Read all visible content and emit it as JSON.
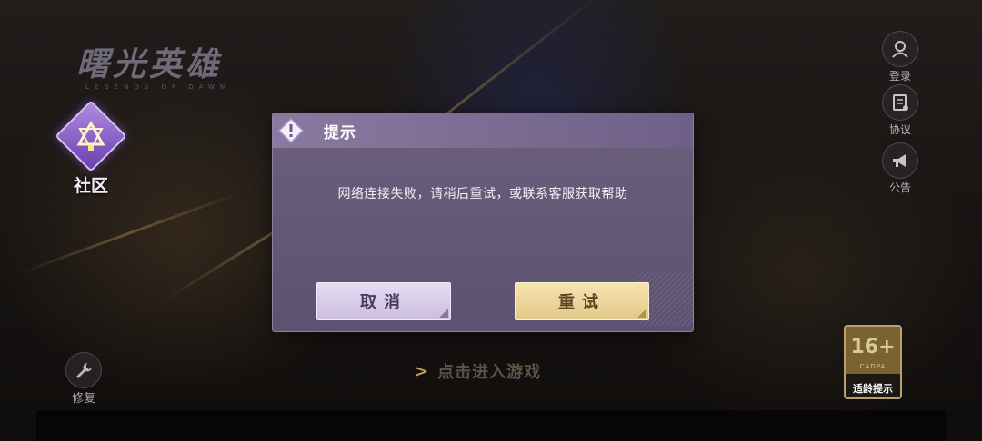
{
  "logo": {
    "title": "曙光英雄",
    "subtitle": "LEGENDS OF DAWN"
  },
  "community": {
    "label": "社区",
    "icon": "community-diamond-icon"
  },
  "side_buttons": [
    {
      "label": "登录",
      "icon": "user-icon"
    },
    {
      "label": "协议",
      "icon": "agreement-icon"
    },
    {
      "label": "公告",
      "icon": "megaphone-icon"
    }
  ],
  "repair": {
    "label": "修复",
    "icon": "wrench-icon"
  },
  "start": {
    "label": "点击进入游戏"
  },
  "age_rating": {
    "number": "16+",
    "org": "CADPA",
    "caption": "适龄提示"
  },
  "dialog": {
    "title": "提示",
    "message": "网络连接失败，请稍后重试，或联系客服获取帮助",
    "cancel_label": "取消",
    "retry_label": "重试"
  },
  "colors": {
    "dialog_bg": "#5d5270",
    "cancel_bg": "#cbbde0",
    "retry_bg": "#e3c98a"
  }
}
